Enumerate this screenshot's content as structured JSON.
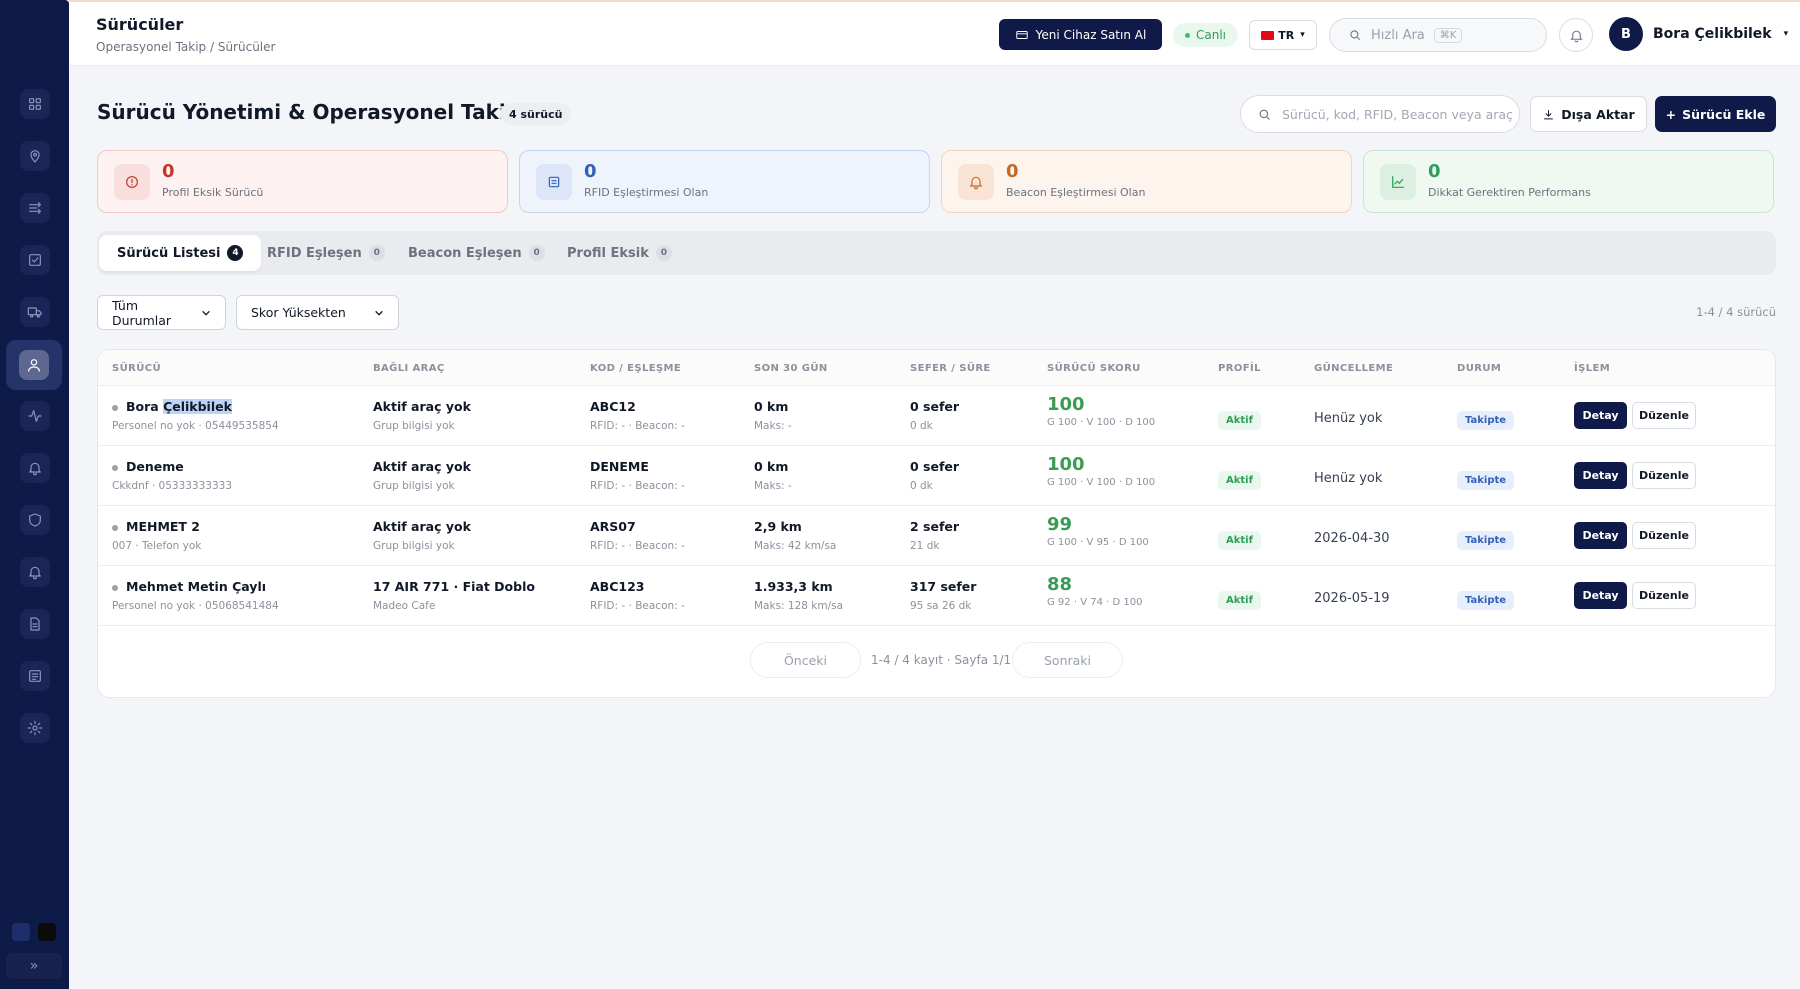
{
  "header": {
    "title": "Sürücüler",
    "breadcrumb": "Operasyonel Takip / Sürücüler",
    "buy_device": "Yeni Cihaz Satın Al",
    "live": "Canlı",
    "lang": "TR",
    "quick_search_placeholder": "Hızlı Ara",
    "quick_search_kbd": "⌘K",
    "user_initial": "B",
    "user_name": "Bora Çelikbilek"
  },
  "page": {
    "title": "Sürücü Yönetimi & Operasyonel Takip",
    "count_badge": "4 sürücü",
    "search_placeholder": "Sürücü, kod, RFID, Beacon veya araç",
    "export_label": "Dışa Aktar",
    "add_label": "Sürücü Ekle"
  },
  "stats": [
    {
      "value": "0",
      "label": "Profil Eksik Sürücü",
      "color": "#c0392b"
    },
    {
      "value": "0",
      "label": "RFID Eşleştirmesi Olan",
      "color": "#3560b8"
    },
    {
      "value": "0",
      "label": "Beacon Eşleştirmesi Olan",
      "color": "#c26a2a"
    },
    {
      "value": "0",
      "label": "Dikkat Gerektiren Performans",
      "color": "#2f9d57"
    }
  ],
  "tabs": [
    {
      "label": "Sürücü Listesi",
      "count": "4"
    },
    {
      "label": "RFID Eşleşen",
      "count": "0"
    },
    {
      "label": "Beacon Eşleşen",
      "count": "0"
    },
    {
      "label": "Profil Eksik",
      "count": "0"
    }
  ],
  "filters": {
    "status": "Tüm Durumlar",
    "sort": "Skor Yüksekten",
    "range": "1-4 / 4 sürücü"
  },
  "columns": [
    "SÜRÜCÜ",
    "BAĞLI ARAÇ",
    "KOD / EŞLEŞME",
    "SON 30 GÜN",
    "SEFER / SÜRE",
    "SÜRÜCÜ SKORU",
    "PROFİL",
    "GÜNCELLEME",
    "DURUM",
    "İŞLEM"
  ],
  "rows": [
    {
      "name_a": "Bora ",
      "name_b": "Çelikbilek",
      "name_sub": "Personel no yok · 05449535854",
      "vehicle": "Aktif araç yok",
      "vehicle_sub": "Grup bilgisi yok",
      "code": "ABC12",
      "code_sub": "RFID: - · Beacon: -",
      "distance": "0 km",
      "distance_sub": "Maks: -",
      "trips": "0 sefer",
      "trips_sub": "0 dk",
      "score": "100",
      "score_sub": "G 100 · V 100 · D 100",
      "profile": "Aktif",
      "updated": "Henüz yok",
      "status": "Takipte"
    },
    {
      "name_a": "Deneme",
      "name_b": "",
      "name_sub": "Ckkdnf · 05333333333",
      "vehicle": "Aktif araç yok",
      "vehicle_sub": "Grup bilgisi yok",
      "code": "DENEME",
      "code_sub": "RFID: - · Beacon: -",
      "distance": "0 km",
      "distance_sub": "Maks: -",
      "trips": "0 sefer",
      "trips_sub": "0 dk",
      "score": "100",
      "score_sub": "G 100 · V 100 · D 100",
      "profile": "Aktif",
      "updated": "Henüz yok",
      "status": "Takipte"
    },
    {
      "name_a": "MEHMET 2",
      "name_b": "",
      "name_sub": "007 · Telefon yok",
      "vehicle": "Aktif araç yok",
      "vehicle_sub": "Grup bilgisi yok",
      "code": "ARS07",
      "code_sub": "RFID: - · Beacon: -",
      "distance": "2,9 km",
      "distance_sub": "Maks: 42 km/sa",
      "trips": "2 sefer",
      "trips_sub": "21 dk",
      "score": "99",
      "score_sub": "G 100 · V 95 · D 100",
      "profile": "Aktif",
      "updated": "2026-04-30",
      "status": "Takipte"
    },
    {
      "name_a": "Mehmet Metin Çaylı",
      "name_b": "",
      "name_sub": "Personel no yok · 05068541484",
      "vehicle": "17 AIR 771 · Fiat Doblo",
      "vehicle_sub": "Madeo Cafe",
      "code": "ABC123",
      "code_sub": "RFID: - · Beacon: -",
      "distance": "1.933,3 km",
      "distance_sub": "Maks: 128 km/sa",
      "trips": "317 sefer",
      "trips_sub": "95 sa 26 dk",
      "score": "88",
      "score_sub": "G 92 · V 74 · D 100",
      "profile": "Aktif",
      "updated": "2026-05-19",
      "status": "Takipte"
    }
  ],
  "actions": {
    "detail": "Detay",
    "edit": "Düzenle"
  },
  "pagination": {
    "prev": "Önceki",
    "info": "1-4 / 4 kayıt · Sayfa 1/1",
    "next": "Sonraki"
  },
  "colors": {
    "brand": "#0f1a48",
    "sidebar": "#0e1a47",
    "score_green": "#3b9b55"
  }
}
